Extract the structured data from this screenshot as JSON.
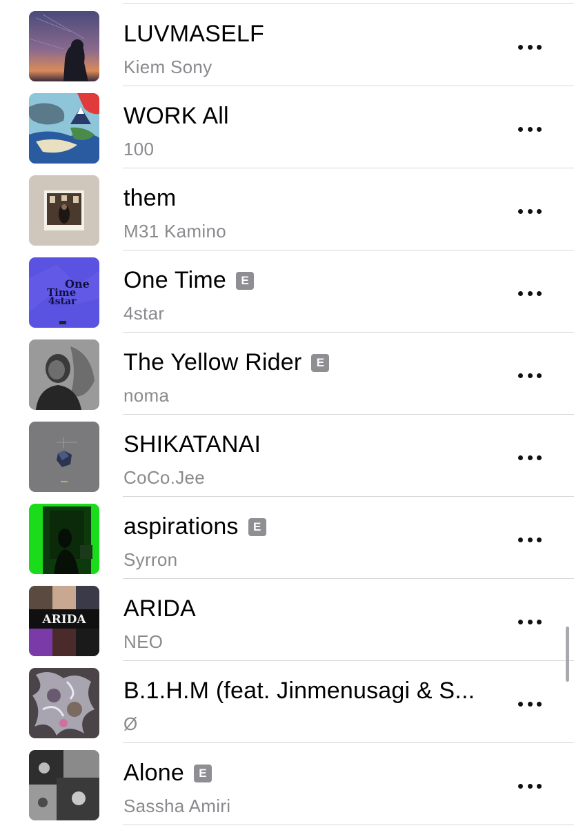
{
  "songs": [
    {
      "title": "LUVMASELF",
      "artist": "Kiem Sony",
      "explicit": false,
      "art": "art-night",
      "more_label": "More"
    },
    {
      "title": "WORK All",
      "artist": "100",
      "explicit": false,
      "art": "art-landscape",
      "more_label": "More"
    },
    {
      "title": "them",
      "artist": "M31 Kamino",
      "explicit": false,
      "art": "art-photo",
      "more_label": "More"
    },
    {
      "title": "One Time",
      "artist": "4star",
      "explicit": true,
      "explicit_label": "E",
      "art": "art-onetime",
      "art_text": [
        "One",
        "Time",
        "4star"
      ],
      "more_label": "More"
    },
    {
      "title": "The Yellow Rider",
      "artist": "noma",
      "explicit": true,
      "explicit_label": "E",
      "art": "art-bw-portrait",
      "more_label": "More"
    },
    {
      "title": "SHIKATANAI",
      "artist": "CoCo.Jee",
      "explicit": false,
      "art": "art-gray-gem",
      "more_label": "More"
    },
    {
      "title": "aspirations",
      "artist": "Syrron",
      "explicit": true,
      "explicit_label": "E",
      "art": "art-green",
      "more_label": "More"
    },
    {
      "title": "ARIDA",
      "artist": "NEO",
      "explicit": false,
      "art": "art-collage",
      "art_text": [
        "ARIDA"
      ],
      "more_label": "More"
    },
    {
      "title": "B.1.H.M (feat. Jinmenusagi & S...",
      "artist": "Ø",
      "explicit": false,
      "art": "art-chrome",
      "more_label": "More"
    },
    {
      "title": "Alone",
      "artist": "Sassha Amiri",
      "explicit": true,
      "explicit_label": "E",
      "art": "art-bw-collage",
      "more_label": "More"
    }
  ],
  "colors": {
    "title": "#000000",
    "artist": "#8a8a8e",
    "divider": "#d6d6d8",
    "explicit_badge": "#8e8e93",
    "scrollbar": "#a8a8ad"
  }
}
